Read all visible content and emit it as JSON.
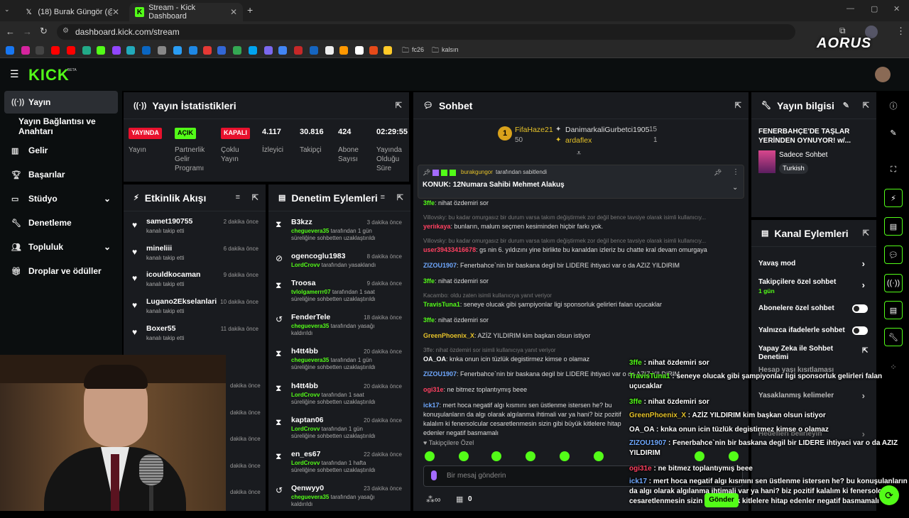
{
  "browser": {
    "tabs": [
      {
        "title": "(18) Burak Güngör (@gungorbu"
      },
      {
        "title": "Stream - Kick Dashboard"
      }
    ],
    "url": "dashboard.kick.com/stream",
    "bookmarks": [
      "fc26",
      "kalsın"
    ],
    "brand": "AORUS"
  },
  "kick": {
    "logo": "KICK",
    "beta": "BETA"
  },
  "sidebar": {
    "items": [
      "Yayın",
      "Yayın Bağlantısı ve Anahtarı",
      "Gelir",
      "Başarılar",
      "Stüdyo",
      "Denetleme",
      "Topluluk",
      "Droplar ve ödüller"
    ]
  },
  "stats": {
    "title": "Yayın İstatistikleri",
    "badges": [
      {
        "badge": "YAYINDA",
        "label": "Yayın"
      },
      {
        "badge": "AÇIK",
        "label": "Partnerlik Gelir Programı"
      },
      {
        "badge": "KAPALI",
        "label": "Çoklu Yayın"
      }
    ],
    "values": [
      {
        "v": "4.117",
        "l": "İzleyici"
      },
      {
        "v": "30.816",
        "l": "Takipçi"
      },
      {
        "v": "424",
        "l": "Abone Sayısı"
      },
      {
        "v": "02:29:55",
        "l": "Yayında Olduğu Süre"
      }
    ]
  },
  "activity": {
    "title": "Etkinlik Akışı",
    "rows": [
      {
        "name": "samet190755",
        "action": "kanalı takip etti",
        "time": "2 dakika önce"
      },
      {
        "name": "mineliii",
        "action": "kanalı takip etti",
        "time": "6 dakika önce"
      },
      {
        "name": "icouldkocaman",
        "action": "kanalı takip etti",
        "time": "9 dakika önce"
      },
      {
        "name": "Lugano2Ekselanlari",
        "action": "kanalı takip etti",
        "time": "10 dakika önce"
      },
      {
        "name": "Boxer55",
        "action": "kanalı takip etti",
        "time": "11 dakika önce"
      }
    ],
    "partial": [
      "dakika önce",
      "dakika önce",
      "dakika önce",
      "dakika önce",
      "dakika önce"
    ]
  },
  "moderation": {
    "title": "Denetim Eylemleri",
    "rows": [
      {
        "name": "B3kzz",
        "time": "3 dakika önce",
        "by": "cheguevera35",
        "desc": " tarafından 1 gün süreliğine sohbetten uzaklaştırıldı"
      },
      {
        "name": "ogencoglu1983",
        "time": "8 dakika önce",
        "by": "LordCrovv",
        "desc": " tarafından yasaklandı"
      },
      {
        "name": "Troosa",
        "time": "9 dakika önce",
        "by": "tvlolgamerrr07",
        "desc": " tarafından 1 saat süreliğine sohbetten uzaklaştırıldı"
      },
      {
        "name": "FenderTele",
        "time": "18 dakika önce",
        "by": "cheguevera35",
        "desc": " tarafından yasağı kaldırıldı"
      },
      {
        "name": "h4tt4bb",
        "time": "20 dakika önce",
        "by": "cheguevera35",
        "desc": " tarafından 1 gün süreliğine sohbetten uzaklaştırıldı"
      },
      {
        "name": "h4tt4bb",
        "time": "20 dakika önce",
        "by": "LordCrovv",
        "desc": " tarafından 1 saat süreliğine sohbetten uzaklaştırıldı"
      },
      {
        "name": "kaptan06",
        "time": "20 dakika önce",
        "by": "LordCrovv",
        "desc": " tarafından 1 gün süreliğine sohbetten uzaklaştırıldı"
      },
      {
        "name": "en_es67",
        "time": "22 dakika önce",
        "by": "LordCrovv",
        "desc": " tarafından 1 hafta süreliğine sohbetten uzaklaştırıldı"
      },
      {
        "name": "Qenwyy0",
        "time": "23 dakika önce",
        "by": "cheguevera35",
        "desc": " tarafından yasağı kaldırıldı"
      }
    ]
  },
  "chat": {
    "title": "Sohbet",
    "gifters": [
      {
        "name": "FifaHaze21",
        "count": "50"
      },
      {
        "name": "DanimarkaliGurbetci1905",
        "count": "15"
      },
      {
        "name": "ardaflex",
        "count": "1"
      }
    ],
    "rank": "1",
    "pinned": {
      "by": "burakgungor",
      "by_suffix": " tarafından sabitlendi",
      "text": "KONUK: 12Numara Sahibi Mehmet Alakuş"
    },
    "lines": [
      {
        "user": "3ffe",
        "color": "#53fc18",
        "text": ": nihat özdemiri sor"
      },
      {
        "reply": "Villovsky: bu kadar omurgasız bir durum varsa takım değiştirmek zor değil bence tavsiye olarak isimli kullanıcıy..."
      },
      {
        "user": "yeriıkaya",
        "color": "#ff4060",
        "text": ": bunların, malum seçmen kesiminden hiçbir farkı yok."
      },
      {
        "reply": "Villovsky: bu kadar omurgasız bir durum varsa takım değiştirmek zor değil bence tavsiye olarak isimli kullanıcıy..."
      },
      {
        "user": "user39433416678",
        "color": "#ff4060",
        "text": ": gs nin 6. yıldızını yine birlikte bu kanaldan izleriz bu chatte kral devam omurgaya"
      },
      {
        "user": "ZIZOU1907",
        "color": "#6fa8ff",
        "text": ": Fenerbahce`nin bir baskana degil bir LIDERE ihtiyaci var o da AZIZ YILDIRIM"
      },
      {
        "user": "3ffe",
        "color": "#53fc18",
        "text": ": nihat özdemiri sor"
      },
      {
        "reply": "Kacambo: oldu zaten isimli kullanıcıya yanıt veriyor"
      },
      {
        "user": "TravisTuna1",
        "color": "#53fc18",
        "text": ": seneye olucak gibi şampiyonlar ligi sponsorluk gelirleri falan uçucaklar"
      },
      {
        "user": "3ffe",
        "color": "#53fc18",
        "text": ": nihat özdemiri sor"
      },
      {
        "user": "GreenPhoenix_X",
        "color": "#e6c229",
        "text": ": AZİZ YILDIRIM kim başkan olsun istiyor"
      },
      {
        "reply": "3ffe: nihat özdemiri sor isimli kullanıcıya yanıt veriyor"
      },
      {
        "user": "OA_OA",
        "color": "#ffffff",
        "text": ": knka onun icin tüzlük degistirmez kimse o olamaz"
      },
      {
        "user": "ZIZOU1907",
        "color": "#6fa8ff",
        "text": ": Fenerbahce`nin bir baskana degil bir LIDERE ihtiyaci var o da AZIZ YILDIRIM"
      },
      {
        "user": "ogi31e",
        "color": "#ff4060",
        "text": ": ne bitmez toplantıymış beee"
      },
      {
        "user": "ick17",
        "color": "#6fa8ff",
        "text": ": mert hoca negatif algı kısmını sen üstlenme istersen he? bu konuşulanların da algı olarak algılanma ihtimali var ya hani? biz pozitif kalalım ki fenersolcular cesaretlenmesin sizin gibi büyük kitlelere hitap edenler negatif basmamalı"
      }
    ],
    "follower_mode": "Takipçilere Özel",
    "input_placeholder": "Bir mesaj gönderin",
    "counter": "0"
  },
  "stream_info": {
    "title": "Yayın bilgisi",
    "stream_title": "FENERBAHÇE'DE TAŞLAR YERİNDEN OYNUYOR! w/...",
    "category": "Sadece Sohbet",
    "language": "Turkish"
  },
  "channel_actions": {
    "title": "Kanal Eylemleri",
    "items": [
      {
        "label": "Yavaş mod"
      },
      {
        "label": "Takipçilere özel sohbet",
        "sub": "1 gün"
      },
      {
        "label": "Abonelere özel sohbet"
      },
      {
        "label": "Yalnızca ifadelerle sohbet"
      },
      {
        "label": "Yapay Zeka ile Sohbet Denetimi"
      },
      {
        "label": "Hesap yaşı kısıtlaması"
      },
      {
        "label": "Yasaklanmış kelimeler"
      },
      {
        "label": "Hedefleri belirleyin"
      }
    ]
  },
  "overlay": {
    "lines": [
      {
        "user": "3ffe",
        "color": "#53fc18",
        "text": " : nihat özdemiri sor"
      },
      {
        "user": "TravisTuna1",
        "color": "#53fc18",
        "text": " : seneye olucak gibi şampiyonlar ligi sponsorluk gelirleri falan uçucaklar"
      },
      {
        "user": "3ffe",
        "color": "#53fc18",
        "text": " : nihat özdemiri sor"
      },
      {
        "user": "GreenPhoenix_X",
        "color": "#e6c229",
        "text": " : AZİZ YILDIRIM kim başkan olsun istiyor"
      },
      {
        "user": "OA_OA",
        "color": "#ffffff",
        "text": " : knka onun icin tüzlük degistirmez kimse o olamaz"
      },
      {
        "user": "ZIZOU1907",
        "color": "#6fa8ff",
        "text": " : Fenerbahce`nin bir baskana degil bir LIDERE ihtiyaci var o da AZIZ YILDIRIM"
      },
      {
        "user": "ogi31e",
        "color": "#ff4060",
        "text": " : ne bitmez toplantıymış beee"
      },
      {
        "user": "ick17",
        "color": "#6fa8ff",
        "text": " : mert hoca negatif algı kısmını sen üstlenme istersen he? bu konuşulanların da algı olarak algılanma ihtimali var ya hani? biz pozitif kalalım ki fenersolcular cesaretlenmesin sizin gibi büyük kitlelere hitap edenler negatif basmamalı"
      }
    ],
    "send": "Gönder"
  },
  "colors": {
    "kick_green": "#53fc18",
    "panel": "#191b1f",
    "live_red": "#e8112d"
  }
}
